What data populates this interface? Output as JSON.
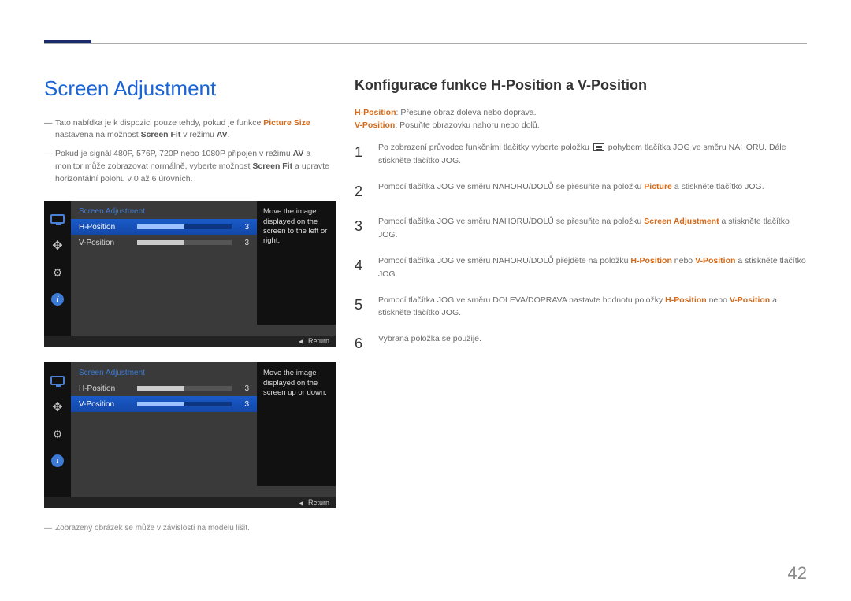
{
  "page_number": "42",
  "left": {
    "heading": "Screen Adjustment",
    "note1_pre": "Tato nabídka je k dispozici pouze tehdy, pokud je funkce ",
    "note1_orange": "Picture Size",
    "note1_mid": " nastavena na možnost ",
    "note1_bold1": "Screen Fit",
    "note1_mid2": " v režimu ",
    "note1_bold2": "AV",
    "note1_end": ".",
    "note2_pre": "Pokud je signál 480P, 576P, 720P nebo 1080P připojen v režimu ",
    "note2_bold1": "AV",
    "note2_mid": " a monitor může zobrazovat normálně, vyberte možnost ",
    "note2_bold2": "Screen Fit",
    "note2_end": " a upravte horizontální polohu v 0 až 6 úrovních.",
    "caption": "Zobrazený obrázek se může v závislosti na modelu lišit."
  },
  "osd1": {
    "title": "Screen Adjustment",
    "row1_label": "H-Position",
    "row1_val": "3",
    "row2_label": "V-Position",
    "row2_val": "3",
    "help": "Move the image displayed on the screen to the left or right.",
    "return": "Return"
  },
  "osd2": {
    "title": "Screen Adjustment",
    "row1_label": "H-Position",
    "row1_val": "3",
    "row2_label": "V-Position",
    "row2_val": "3",
    "help": "Move the image displayed on the screen up or down.",
    "return": "Return"
  },
  "right": {
    "heading": "Konfigurace funkce H-Position a V-Position",
    "def1_key": "H-Position",
    "def1_txt": ": Přesune obraz doleva nebo doprava.",
    "def2_key": "V-Position",
    "def2_txt": ": Posuňte obrazovku nahoru nebo dolů.",
    "steps": {
      "s1_a": "Po zobrazení průvodce funkčními tlačítky vyberte položku ",
      "s1_b": " pohybem tlačítka JOG ve směru NAHORU. Dále stiskněte tlačítko JOG.",
      "s2_a": "Pomocí tlačítka JOG ve směru NAHORU/DOLŮ se přesuňte na položku ",
      "s2_k": "Picture",
      "s2_b": " a stiskněte tlačítko JOG.",
      "s3_a": "Pomocí tlačítka JOG ve směru NAHORU/DOLŮ se přesuňte na položku ",
      "s3_k": "Screen Adjustment",
      "s3_b": " a stiskněte tlačítko JOG.",
      "s4_a": "Pomocí tlačítka JOG ve směru NAHORU/DOLŮ přejděte na položku ",
      "s4_k1": "H-Position",
      "s4_mid": " nebo ",
      "s4_k2": "V-Position",
      "s4_b": " a stiskněte tlačítko JOG.",
      "s5_a": "Pomocí tlačítka JOG ve směru DOLEVA/DOPRAVA nastavte hodnotu položky ",
      "s5_k1": "H-Position",
      "s5_mid": " nebo ",
      "s5_k2": "V-Position",
      "s5_b": " a stiskněte tlačítko JOG.",
      "s6": "Vybraná položka se použije."
    },
    "nums": {
      "n1": "1",
      "n2": "2",
      "n3": "3",
      "n4": "4",
      "n5": "5",
      "n6": "6"
    }
  }
}
